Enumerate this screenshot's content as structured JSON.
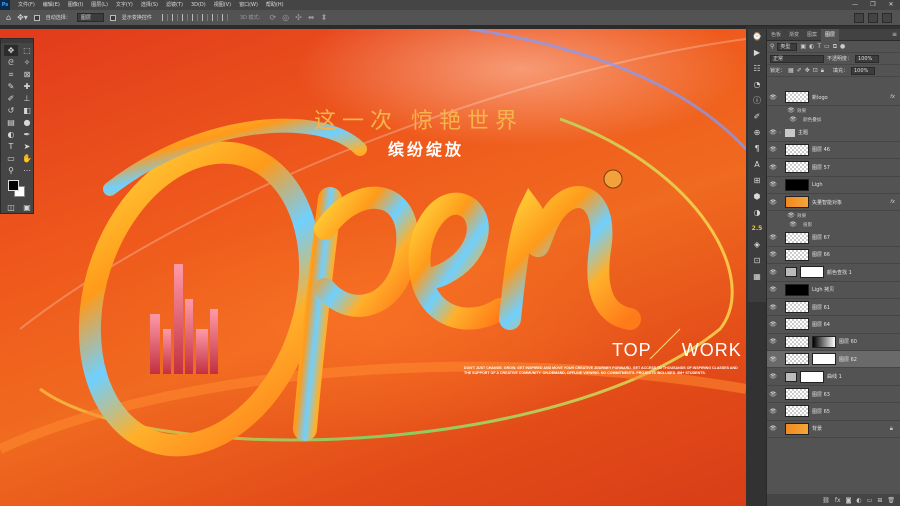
{
  "app": {
    "logo": "Ps"
  },
  "menu": [
    "文件(F)",
    "编辑(E)",
    "图像(I)",
    "图层(L)",
    "文字(Y)",
    "选择(S)",
    "滤镜(T)",
    "3D(D)",
    "视图(V)",
    "窗口(W)",
    "帮助(H)"
  ],
  "window_controls": [
    "—",
    "❐",
    "✕"
  ],
  "options": {
    "auto_select_label": "自动选择：",
    "auto_select_value": "图层",
    "show_transform_label": "显示变换控件",
    "mode_3d_label": "3D 模式："
  },
  "tools": [
    "move",
    "marquee",
    "lasso",
    "magic-wand",
    "crop",
    "frame",
    "eyedropper",
    "healing",
    "brush",
    "stamp",
    "history-brush",
    "eraser",
    "gradient",
    "blur",
    "dodge",
    "pen",
    "type",
    "path-select",
    "shape",
    "hand",
    "zoom",
    "more"
  ],
  "side_strip": {
    "badge": "2.5"
  },
  "canvas": {
    "headline": "这一次 惊艳世界",
    "subheadline": "缤纷绽放",
    "brand_left": "TOP",
    "brand_right": "WORK",
    "tagline": "DON'T JUST CHANGE. GROW. GET INSPIRED AND MOVE YOUR CREATIVE JOURNEY FORWARD. GET ACCESS TO THOUSANDS OF INSPIRING CLASSES AND THE SUPPORT OF A CREATIVE COMMUNITY. ON-DEMAND, OFFLINE VIEWING. NO COMMITMENTS. PROJECTS INCLUDED. 8M+ STUDENTS."
  },
  "panel": {
    "tabs": [
      "色板",
      "渐变",
      "图案",
      "图层"
    ],
    "kind_filter": "类型",
    "blend_mode": "正常",
    "opacity_label": "不透明度：",
    "opacity_value": "100%",
    "lock_label": "锁定：",
    "fill_label": "填充：",
    "fill_value": "100%"
  },
  "layers": [
    {
      "name": "新logo",
      "thumb": "checker",
      "fx": "fx"
    },
    {
      "name": "效果",
      "sub": true
    },
    {
      "name": "颜色叠加",
      "sub": true,
      "deep": true
    },
    {
      "name": "主题",
      "thumb": "folder"
    },
    {
      "name": "图层 46",
      "thumb": "checker"
    },
    {
      "name": "图层 57",
      "thumb": "checker"
    },
    {
      "name": "Ligh",
      "thumb": "black"
    },
    {
      "name": "矢量智能对象",
      "thumb": "orange",
      "fx": "fx"
    },
    {
      "name": "效果",
      "sub": true
    },
    {
      "name": "投影",
      "sub": true,
      "deep": true
    },
    {
      "name": "图层 67",
      "thumb": "checker"
    },
    {
      "name": "图层 66",
      "thumb": "checker"
    },
    {
      "name": "颜色查找 1",
      "thumb": "adj",
      "mask": "white"
    },
    {
      "name": "Ligh 拷贝",
      "thumb": "black"
    },
    {
      "name": "图层 61",
      "thumb": "checker"
    },
    {
      "name": "图层 64",
      "thumb": "checker"
    },
    {
      "name": "图层 60",
      "thumb": "checker",
      "mask": "gradient"
    },
    {
      "name": "图层 62",
      "thumb": "checker",
      "mask": "white",
      "selected": true
    },
    {
      "name": "曲线 1",
      "thumb": "adj",
      "mask": "white"
    },
    {
      "name": "图层 63",
      "thumb": "checker"
    },
    {
      "name": "图层 65",
      "thumb": "checker"
    },
    {
      "name": "背景",
      "thumb": "orange",
      "locked": true
    }
  ],
  "colors": {
    "canvas_base": "#ef5a1c",
    "headline": "#f7b44a",
    "ui_dark": "#323232",
    "ui_panel": "#535353"
  }
}
